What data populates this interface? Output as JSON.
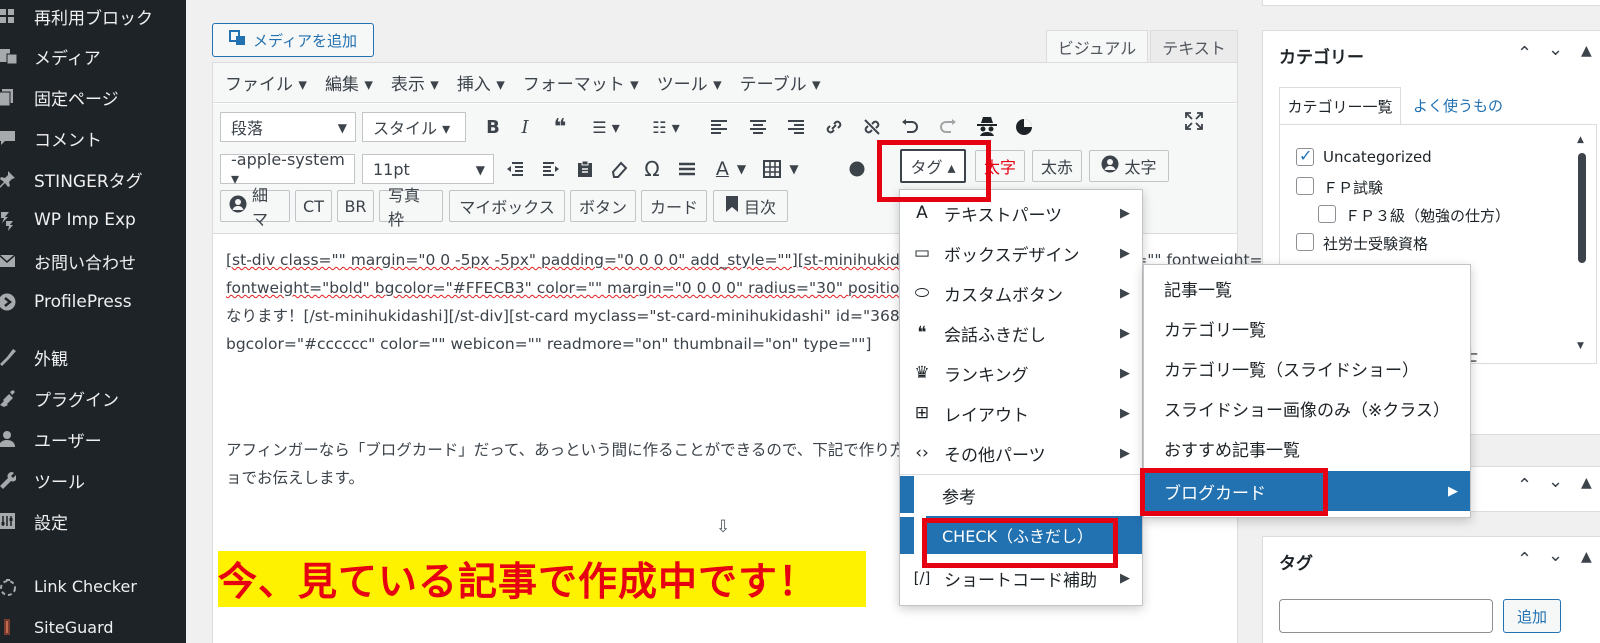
{
  "sidebar": {
    "items": [
      {
        "label": "再利用ブロック",
        "icon": "blocks-icon"
      },
      {
        "label": "メディア",
        "icon": "media-icon"
      },
      {
        "label": "固定ページ",
        "icon": "pages-icon"
      },
      {
        "label": "コメント",
        "icon": "comments-icon"
      },
      {
        "label": "STINGERタグ",
        "icon": "pin-icon"
      },
      {
        "label": "WP Imp Exp",
        "icon": "import-export-icon"
      },
      {
        "label": "お問い合わせ",
        "icon": "mail-icon"
      },
      {
        "label": "ProfilePress",
        "icon": "profilepress-icon"
      },
      {
        "label": "外観",
        "icon": "appearance-icon"
      },
      {
        "label": "プラグイン",
        "icon": "plugins-icon"
      },
      {
        "label": "ユーザー",
        "icon": "users-icon"
      },
      {
        "label": "ツール",
        "icon": "tools-icon"
      },
      {
        "label": "設定",
        "icon": "settings-icon"
      },
      {
        "label": "Link Checker",
        "icon": "link-checker-icon"
      },
      {
        "label": "SiteGuard",
        "icon": "siteguard-icon"
      }
    ]
  },
  "editor": {
    "add_media": "メディアを追加",
    "tabs": {
      "visual": "ビジュアル",
      "text": "テキスト"
    },
    "menu": [
      "ファイル ▾",
      "編集 ▾",
      "表示 ▾",
      "挿入 ▾",
      "フォーマット ▾",
      "ツール ▾",
      "テーブル ▾"
    ],
    "toolbar": {
      "format_select": "段落",
      "style_select": "スタイル ▾",
      "font_select": "-apple-system ▾",
      "size_select": "11pt",
      "tag_button": "タグ ▴",
      "btn_futoji_aka": "太字",
      "btn_futoaka": "太赤",
      "btn_futoji": "太字",
      "btn_hosoma": "細マ",
      "btn_ct": "CT",
      "btn_br": "BR",
      "btn_shashin": "写真枠",
      "btn_mybox": "マイボックス",
      "btn_button": "ボタン",
      "btn_card": "カード",
      "btn_toc": "目次"
    },
    "content": {
      "line1": "[st-div class=\"\" margin=\"0 0 -5px -5px\" padding=\"0 0 0 0\" add_style=\"\"][st-minihukidashi fontawesome=\"\" fontsize=\"\" fontweight=\"\"",
      "line2": "fontweight=\"bold\" bgcolor=\"#FFECB3\" color=\"\" margin=\"0 0 0 0\" radius=\"30\" position=\"\" add_boxstyle=\"\"]こんな感じの表示に",
      "line3": "なります！[/st-minihukidashi][/st-div][st-card myclass=\"st-card-minihukidashi\" id=\"3685\" label=\"\" pc_height=\"\" name=\"\"",
      "line4": "bgcolor=\"#cccccc\" color=\"\" webicon=\"\" readmore=\"on\" thumbnail=\"on\" type=\"\"]",
      "line5": "アフィンガーなら「ブログカード」だって、あっという間に作ることができるので、下記で作り方の手順",
      "line6": "ョでお伝えします。",
      "arrow": "⇩",
      "highlight": "今、見ている記事で作成中です！"
    }
  },
  "tag_menu": {
    "items": [
      {
        "label": "テキストパーツ",
        "icon": "A",
        "submenu": true
      },
      {
        "label": "ボックスデザイン",
        "icon": "▭",
        "submenu": true
      },
      {
        "label": "カスタムボタン",
        "icon": "⬭",
        "submenu": true
      },
      {
        "label": "会話ふきだし",
        "icon": "❝",
        "submenu": true
      },
      {
        "label": "ランキング",
        "icon": "♛",
        "submenu": true
      },
      {
        "label": "レイアウト",
        "icon": "⊞",
        "submenu": true
      },
      {
        "label": "その他パーツ",
        "icon": "‹›",
        "submenu": true
      },
      {
        "label": "参考",
        "icon": "",
        "submenu": false
      },
      {
        "label": "CHECK（ふきだし）",
        "icon": "",
        "submenu": false
      },
      {
        "label": "ショートコード補助",
        "icon": "[/]",
        "submenu": true
      }
    ]
  },
  "submenu": {
    "items": [
      "記事一覧",
      "カテゴリ一覧",
      "カテゴリ一覧（スライドショー）",
      "スライドショー画像のみ（※クラス）",
      "おすすめ記事一覧",
      "ブログカード"
    ]
  },
  "category_panel": {
    "title": "カテゴリー",
    "tab_all": "カテゴリー一覧",
    "tab_popular": "よく使うもの",
    "items": [
      {
        "label": "Uncategorized",
        "checked": true
      },
      {
        "label": "ＦＰ試験",
        "checked": false
      },
      {
        "label": "ＦＰ３級（勉強の仕方）",
        "checked": false
      },
      {
        "label": "社労士受験資格",
        "checked": false
      }
    ],
    "partial_label": "士"
  },
  "tag_panel": {
    "title": "タグ",
    "add_button": "追加"
  },
  "colors": {
    "sidebar_bg": "#1d2327",
    "accent": "#2271b1",
    "highlight_bg": "#fff200",
    "highlight_text": "#e60012",
    "red_box": "#e50012"
  }
}
